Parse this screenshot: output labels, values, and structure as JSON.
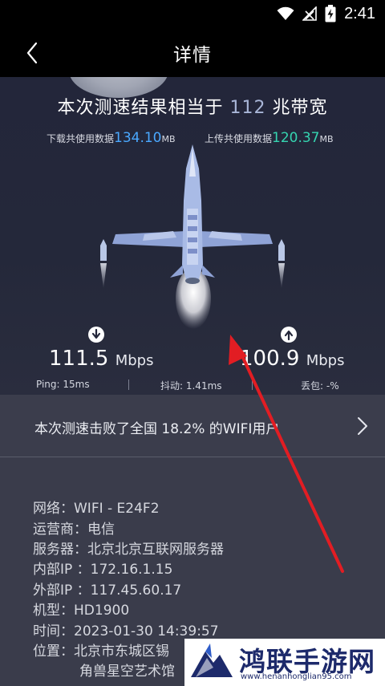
{
  "status_bar": {
    "time": "2:41",
    "icons": [
      "wifi-icon",
      "signal-icon",
      "battery-charging-icon"
    ]
  },
  "app_bar": {
    "title": "详情",
    "back_icon": "chevron-left-icon"
  },
  "result": {
    "headline_prefix": "本次测速结果相当于 ",
    "bandwidth_value": "112",
    "headline_suffix": " 兆带宽",
    "download_usage_label": "下载共使用数据",
    "download_usage_value": "134.10",
    "download_usage_unit": "MB",
    "upload_usage_label": "上传共使用数据",
    "upload_usage_value": "120.37",
    "upload_usage_unit": "MB",
    "download_speed": "111.5",
    "upload_speed": "100.9",
    "speed_unit": "Mbps",
    "ping": "Ping: 15ms",
    "jitter": "抖动: 1.41ms",
    "loss": "丢包: -%"
  },
  "beat": {
    "text": "本次测速击败了全国 18.2% 的WIFI用户"
  },
  "details": [
    "网络：WIFI - E24F2",
    "运营商：电信",
    "服务器：北京北京互联网服务器",
    "内部IP ：172.16.1.15",
    "外部IP ：117.45.60.17",
    "机型：HD1900",
    "时间：2023-01-30 14:39:57",
    "位置：北京市东城区锡",
    "角兽星空艺术馆"
  ],
  "watermark": {
    "title": "鸿联手游网",
    "url": "www.henanhonglian95.com"
  },
  "colors": {
    "download_accent": "#4aa8ff",
    "upload_accent": "#35d4b0",
    "annotation_arrow": "#e21d23"
  }
}
